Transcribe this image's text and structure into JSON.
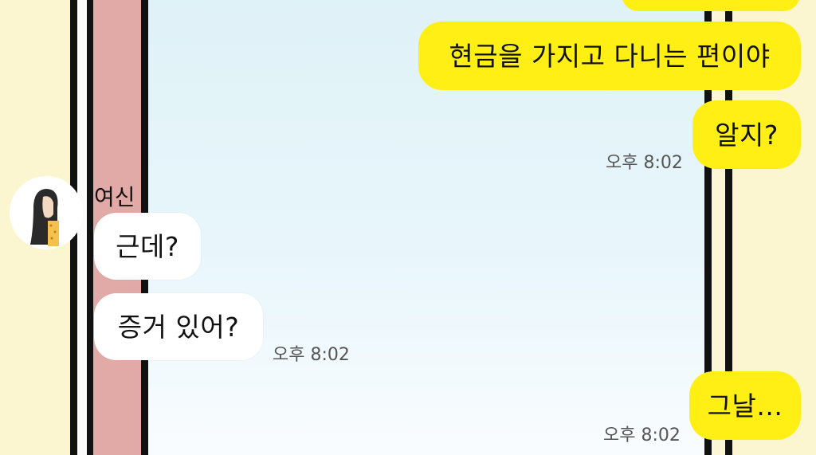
{
  "chat": {
    "sender_name": "여신",
    "messages": [
      {
        "from": "me",
        "text": "현금을 가지고 다니는 편이야"
      },
      {
        "from": "me",
        "text": "알지?",
        "time": "오후 8:02"
      },
      {
        "from": "them",
        "text": "근데?"
      },
      {
        "from": "them",
        "text": "증거 있어?",
        "time": "오후 8:02"
      },
      {
        "from": "me",
        "text": "그날...",
        "time": "오후 8:02"
      }
    ]
  },
  "colors": {
    "my_bubble": "#ffef14",
    "their_bubble": "#ffffff",
    "wall": "#fbf6cf",
    "pink_stripe": "#e2aaa6"
  }
}
